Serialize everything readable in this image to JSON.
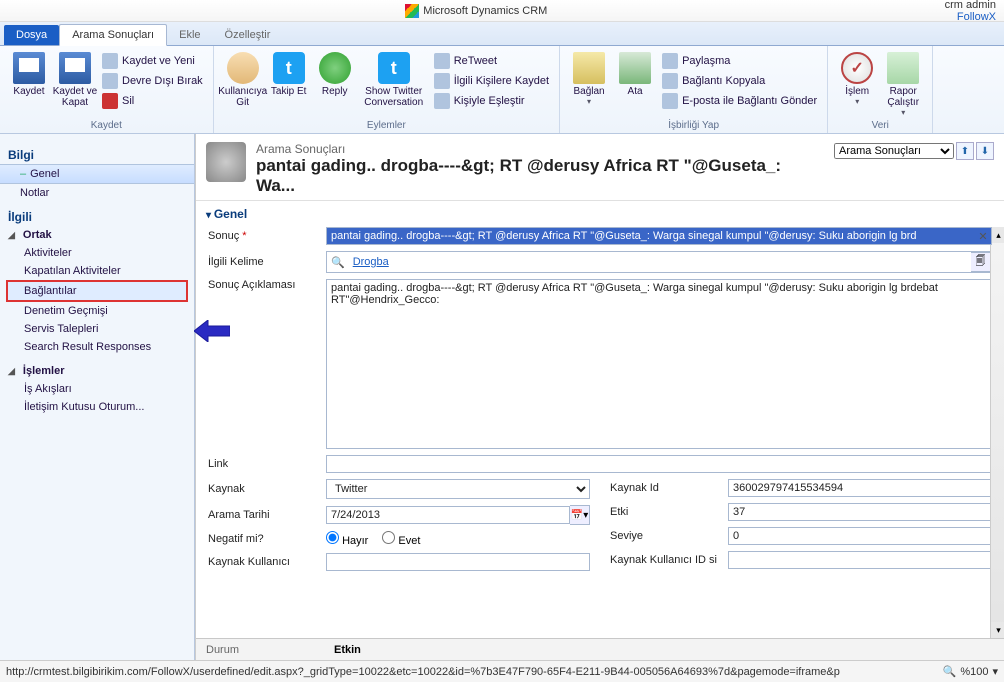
{
  "window": {
    "app_title": "Microsoft Dynamics CRM",
    "user_name": "crm admin",
    "org_name": "FollowX"
  },
  "tabs": {
    "file": "Dosya",
    "main": "Arama Sonuçları",
    "add": "Ekle",
    "customize": "Özelleştir"
  },
  "ribbon": {
    "save_group": "Kaydet",
    "save": "Kaydet",
    "save_close": "Kaydet ve Kapat",
    "save_new": "Kaydet ve Yeni",
    "deactivate": "Devre Dışı Bırak",
    "delete": "Sil",
    "actions_group": "Eylemler",
    "user_go": "Kullanıcıya Git",
    "follow": "Takip Et",
    "reply": "Reply",
    "show_conv": "Show Twitter Conversation",
    "retweet": "ReTweet",
    "ilkisave": "İlgili Kişilere Kaydet",
    "match": "Kişiyle Eşleştir",
    "collab_group": "İşbirliği Yap",
    "connect": "Bağlan",
    "assign": "Ata",
    "share": "Paylaşma",
    "copylink": "Bağlantı Kopyala",
    "emaillink": "E-posta ile Bağlantı Gönder",
    "data_group": "Veri",
    "process": "İşlem",
    "report": "Rapor Çalıştır"
  },
  "left": {
    "info": "Bilgi",
    "general": "Genel",
    "notes": "Notlar",
    "related": "İlgili",
    "common": "Ortak",
    "activities": "Aktiviteler",
    "closed": "Kapatılan Aktiviteler",
    "connections": "Bağlantılar",
    "audit": "Denetim Geçmişi",
    "service": "Servis Talepleri",
    "responses": "Search Result Responses",
    "processes": "İşlemler",
    "workflows": "İş Akışları",
    "dialogs": "İletişim Kutusu Oturum..."
  },
  "header": {
    "breadcrumb": "Arama Sonuçları",
    "title": "pantai gading.. drogba----&gt; RT @derusy Africa RT \"@Guseta_: Wa...",
    "view": "Arama Sonuçları"
  },
  "section": {
    "general": "Genel"
  },
  "form": {
    "result_label": "Sonuç",
    "result_value": "pantai gading.. drogba----&gt; RT @derusy Africa RT \"@Guseta_: Warga sinegal kumpul \"@derusy: Suku aborigin lg brd",
    "keyword_label": "İlgili Kelime",
    "keyword_value": "Drogba",
    "desc_label": "Sonuç Açıklaması",
    "desc_value": "pantai gading.. drogba----&gt; RT @derusy Africa RT \"@Guseta_: Warga sinegal kumpul \"@derusy: Suku aborigin lg brdebat RT\"@Hendrix_Gecco:",
    "link_label": "Link",
    "link_value": "",
    "source_label": "Kaynak",
    "source_value": "Twitter",
    "sourceid_label": "Kaynak Id",
    "sourceid_value": "360029797415534594",
    "date_label": "Arama Tarihi",
    "date_value": "7/24/2013",
    "impact_label": "Etki",
    "impact_value": "37",
    "neg_label": "Negatif mi?",
    "neg_no": "Hayır",
    "neg_yes": "Evet",
    "level_label": "Seviye",
    "level_value": "0",
    "srcuser_label": "Kaynak Kullanıcı",
    "srcuserid_label": "Kaynak Kullanıcı ID si"
  },
  "status": {
    "label": "Durum",
    "value": "Etkin"
  },
  "browser": {
    "url": "http://crmtest.bilgibirikim.com/FollowX/userdefined/edit.aspx?_gridType=10022&etc=10022&id=%7b3E47F790-65F4-E211-9B44-005056A64693%7d&pagemode=iframe&p",
    "zoom": "%100"
  }
}
